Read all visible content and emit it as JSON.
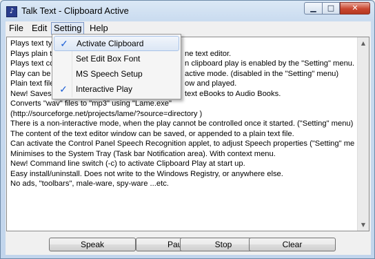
{
  "window": {
    "title": "Talk Text - Clipboard Active",
    "icon": "app-icon",
    "controls": {
      "minimize": "minimize-icon",
      "maximize": "maximize-icon",
      "close": "close-icon"
    }
  },
  "menubar": {
    "file": "File",
    "edit": "Edit",
    "setting": "Setting",
    "help": "Help"
  },
  "setting_menu": {
    "items": [
      {
        "label": "Activate Clipboard",
        "checked": true
      },
      {
        "label": "Set Edit Box Font",
        "checked": false
      },
      {
        "label": "MS Speech Setup",
        "checked": false
      },
      {
        "label": "Interactive Play",
        "checked": true
      }
    ],
    "check_glyph": "✓"
  },
  "editor": {
    "lines": [
      "Plays text typ",
      "Plays plain te",
      "Plays text co",
      "Play can be",
      "Plain text file",
      "New! Saves",
      "Converts \"wav\" files to \"mp3\" using \"Lame.exe\"",
      "(http://sourceforge.net/projects/lame/?source=directory )",
      "There is a non-interactive mode, when the play cannot be controlled once it started. (\"Setting\" menu)",
      "The content of the text editor window can be saved, or appended to a plain text file.",
      "Can activate the Control Panel Speech Recognition applet, to adjust Speech properties (\"Setting\" menu).",
      "Minimises to the System Tray (Task bar Notification area). With context menu.",
      "New! Command line switch (-c) to activate Clipboard Play at start up.",
      "Easy install/uninstall. Does not write to the Windows Registry, or anywhere else.",
      "No ads, \"toolbars\", male-ware, spy-ware ...etc."
    ],
    "partial_right": [
      "",
      "ne text editor.",
      "n clipboard play is enabled by the \"Setting\" menu.",
      "active mode. (disabled in the \"Setting\" menu)",
      "ow and played.",
      "text eBooks to Audio Books."
    ]
  },
  "buttons": {
    "speak": "Speak",
    "pause": "Pause",
    "stop": "Stop",
    "clear": "Clear"
  }
}
